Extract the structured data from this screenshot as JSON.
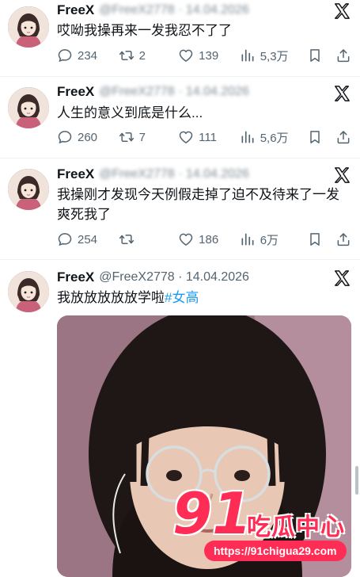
{
  "colors": {
    "accent": "#1d9bf0",
    "watermark": "#ff2d55",
    "muted": "#536471"
  },
  "tweets": [
    {
      "name": "FreeX",
      "handle_meta": "@FreeX2778 · 14.04.2026",
      "text": "哎呦我操再来一发我忍不了了",
      "replies": "234",
      "retweets": "2",
      "likes": "139",
      "views": "5,3万"
    },
    {
      "name": "FreeX",
      "handle_meta": "@FreeX2778 · 14.04.2026",
      "text": "人生的意义到底是什么...",
      "replies": "260",
      "retweets": "7",
      "likes": "111",
      "views": "5,6万"
    },
    {
      "name": "FreeX",
      "handle_meta": "@FreeX2778 · 14.04.2026",
      "text": "我操刚才发现今天例假走掉了迫不及待来了一发爽死我了",
      "replies": "254",
      "retweets": "",
      "likes": "186",
      "views": "6万"
    },
    {
      "name": "FreeX",
      "handle_meta": "@FreeX2778 · 14.04.2026",
      "text": "我放放放放放学啦",
      "hashtag": "#女高"
    }
  ],
  "icons": {
    "platform": "x-logo-icon",
    "reply": "reply-icon",
    "retweet": "retweet-icon",
    "like": "heart-icon",
    "views": "views-icon",
    "bookmark": "bookmark-icon",
    "share": "share-icon"
  },
  "watermark": {
    "number": "91",
    "site_name": "吃瓜中心",
    "url": "https://91chigua29.com"
  }
}
